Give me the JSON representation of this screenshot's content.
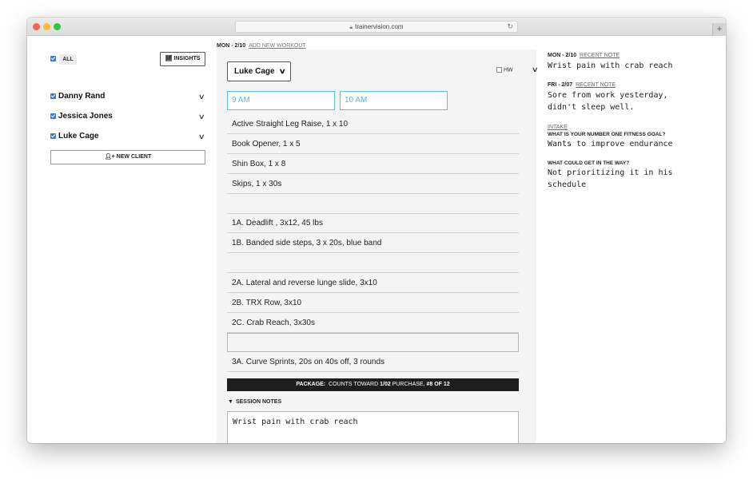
{
  "browser": {
    "url": "trainervision.com"
  },
  "sidebar": {
    "all_label": "ALL",
    "insights_label": "INSIGHTS",
    "clients": [
      {
        "name": "Danny Rand",
        "checked": true
      },
      {
        "name": "Jessica Jones",
        "checked": true
      },
      {
        "name": "Luke Cage",
        "checked": true
      }
    ],
    "new_client_label": "NEW CLIENT"
  },
  "workout": {
    "date": "MON - 2/10",
    "add_link": "ADD NEW WORKOUT",
    "client_selected": "Luke Cage",
    "hw_label": "HW",
    "start_time": "9 AM",
    "end_time": "10 AM",
    "exercises": [
      "Active Straight Leg Raise, 1 x 10",
      "Book Opener, 1 x 5",
      "Shin Box, 1 x 8",
      "Skips, 1 x 30s",
      "",
      "1A. Deadlift , 3x12, 45 lbs",
      "1B. Banded side steps, 3 x 20s, blue band",
      "",
      "2A. Lateral and reverse lunge slide, 3x10",
      "2B. TRX Row, 3x10",
      "2C. Crab Reach, 3x30s",
      "",
      "3A. Curve Sprints, 20s on 40s off, 3 rounds"
    ],
    "package": {
      "label": "PACKAGE:",
      "counts_text": "COUNTS TOWARD",
      "purchase_date": "1/02",
      "purchase_text": "PURCHASE,",
      "session_count": "#8 OF 12"
    },
    "session_notes_label": "SESSION NOTES",
    "session_notes": "Wrist pain with crab reach"
  },
  "notes": {
    "recent": [
      {
        "date": "MON - 2/10",
        "label": "RECENT NOTE",
        "text": "Wrist pain with crab reach"
      },
      {
        "date": "FRI - 2/07",
        "label": "RECENT NOTE",
        "text": "Sore from work yesterday, didn't sleep well."
      }
    ],
    "intake_label": "INTAKE",
    "intake": [
      {
        "question": "WHAT IS YOUR NUMBER ONE FITNESS GOAL?",
        "answer": "Wants to improve endurance"
      },
      {
        "question": "WHAT COULD GET IN THE WAY?",
        "answer": "Not prioritizing it in his schedule"
      }
    ]
  }
}
